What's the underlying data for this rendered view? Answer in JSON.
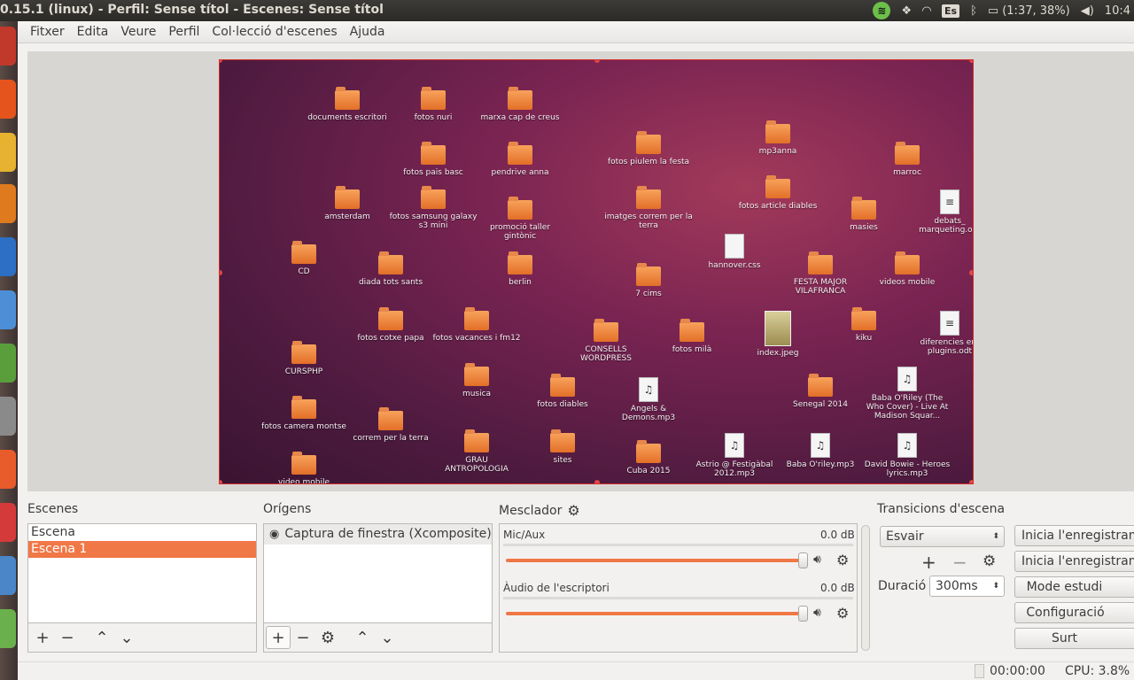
{
  "window": {
    "title": "0.15.1 (linux) - Perfil: Sense títol - Escenes: Sense títol"
  },
  "panel": {
    "keyboard": "Es",
    "battery": "(1:37, 38%)",
    "clock": "10:4"
  },
  "menu": [
    "Fitxer",
    "Edita",
    "Veure",
    "Perfil",
    "Col·lecció d'escenes",
    "Ajuda"
  ],
  "desktop_items": [
    {
      "label": "documents escritori",
      "kind": "folder"
    },
    {
      "label": "fotos nuri",
      "kind": "folder"
    },
    {
      "label": "marxa cap de creus",
      "kind": "folder"
    },
    {
      "label": "fotos piulem la festa",
      "kind": "folder"
    },
    {
      "label": "mp3anna",
      "kind": "folder"
    },
    {
      "label": "fotos pais basc",
      "kind": "folder"
    },
    {
      "label": "pendrive anna",
      "kind": "folder"
    },
    {
      "label": "marroc",
      "kind": "folder"
    },
    {
      "label": "amsterdam",
      "kind": "folder"
    },
    {
      "label": "fotos samsung galaxy s3 mini",
      "kind": "folder"
    },
    {
      "label": "promoció taller gintònic",
      "kind": "folder"
    },
    {
      "label": "imatges correm per la terra",
      "kind": "folder"
    },
    {
      "label": "fotos article diables",
      "kind": "folder"
    },
    {
      "label": "masies",
      "kind": "folder"
    },
    {
      "label": "debats_ marqueting.odt",
      "kind": "doc"
    },
    {
      "label": "CD",
      "kind": "folder"
    },
    {
      "label": "diada tots sants",
      "kind": "folder"
    },
    {
      "label": "berlin",
      "kind": "folder"
    },
    {
      "label": "hannover.css",
      "kind": "file"
    },
    {
      "label": "7 cims",
      "kind": "folder"
    },
    {
      "label": "FESTA MAJOR VILAFRANCA",
      "kind": "folder"
    },
    {
      "label": "videos mobile",
      "kind": "folder"
    },
    {
      "label": "fotos cotxe papa",
      "kind": "folder"
    },
    {
      "label": "fotos vacances i fm12",
      "kind": "folder"
    },
    {
      "label": "CONSELLS WORDPRESS",
      "kind": "folder"
    },
    {
      "label": "fotos milà",
      "kind": "folder"
    },
    {
      "label": "index.jpeg",
      "kind": "image"
    },
    {
      "label": "kiku",
      "kind": "folder"
    },
    {
      "label": "diferencies ent plugins.odt",
      "kind": "doc"
    },
    {
      "label": "CURSPHP",
      "kind": "folder"
    },
    {
      "label": "musica",
      "kind": "folder"
    },
    {
      "label": "fotos diables",
      "kind": "folder"
    },
    {
      "label": "Angels & Demons.mp3",
      "kind": "audio"
    },
    {
      "label": "Senegal 2014",
      "kind": "folder"
    },
    {
      "label": "Baba O'Riley (The Who Cover) - Live At Madison Squar...",
      "kind": "audio"
    },
    {
      "label": "fotos camera montse",
      "kind": "folder"
    },
    {
      "label": "correm per la terra",
      "kind": "folder"
    },
    {
      "label": "GRAU ANTROPOLOGIA",
      "kind": "folder"
    },
    {
      "label": "sites",
      "kind": "folder"
    },
    {
      "label": "Cuba 2015",
      "kind": "folder"
    },
    {
      "label": "Astrio @ Festigàbal 2012.mp3",
      "kind": "audio"
    },
    {
      "label": "Baba O'riley.mp3",
      "kind": "audio"
    },
    {
      "label": "David Bowie - Heroes   lyrics.mp3",
      "kind": "audio"
    },
    {
      "label": "video mobile",
      "kind": "folder"
    }
  ],
  "scenes": {
    "title": "Escenes",
    "items": [
      "Escena",
      "Escena 1"
    ],
    "selected": "Escena 1"
  },
  "sources": {
    "title": "Orígens",
    "items": [
      "Captura de finestra (Xcomposite)"
    ]
  },
  "mixer": {
    "title": "Mesclador",
    "channels": [
      {
        "name": "Mic/Aux",
        "db": "0.0 dB",
        "level": 1.0
      },
      {
        "name": "Àudio de l'escriptori",
        "db": "0.0 dB",
        "level": 1.0
      }
    ]
  },
  "transitions": {
    "title": "Transicions d'escena",
    "selected": "Esvair",
    "duration_label": "Duració",
    "duration_value": "300ms"
  },
  "controls": [
    "Inicia l'enregistram",
    "Inicia l'enregistram",
    "Mode estudi",
    "Configuració",
    "Surt"
  ],
  "status": {
    "time": "00:00:00",
    "cpu": "CPU: 3.8%"
  },
  "colors": {
    "accent": "#f07746",
    "selection_border": "#d02a2a"
  }
}
